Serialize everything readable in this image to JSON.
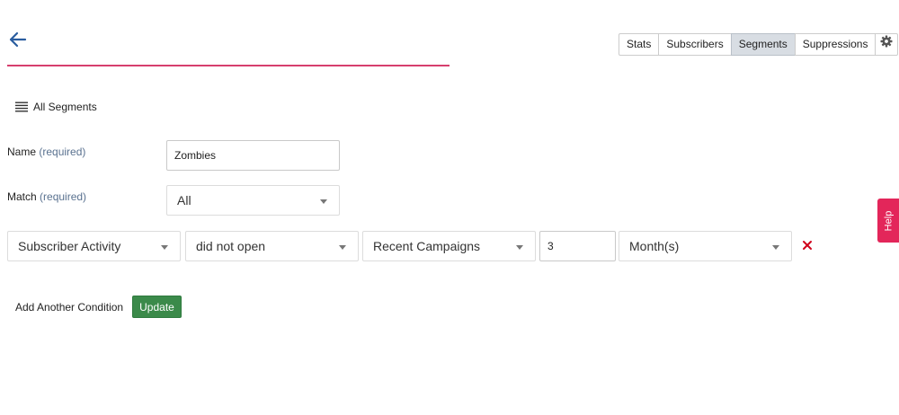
{
  "header": {
    "back_icon": "arrow-left-icon",
    "accent_color": "#d63f6e",
    "tabs": [
      {
        "label": "Stats",
        "active": false
      },
      {
        "label": "Subscribers",
        "active": false
      },
      {
        "label": "Segments",
        "active": true
      },
      {
        "label": "Suppressions",
        "active": false
      }
    ],
    "settings_icon": "gear-icon"
  },
  "nav": {
    "all_segments_label": "All Segments",
    "icon": "hamburger-list-icon"
  },
  "form": {
    "name": {
      "label": "Name",
      "required_text": "(required)",
      "value": "Zombies"
    },
    "match": {
      "label": "Match",
      "required_text": "(required)",
      "selected": "All"
    }
  },
  "condition": {
    "field": "Subscriber Activity",
    "operator": "did not open",
    "target": "Recent Campaigns",
    "count": "3",
    "unit": "Month(s)",
    "remove_icon": "close-x-icon",
    "remove_color": "#d0021b"
  },
  "actions": {
    "add_condition_label": "Add Another Condition",
    "update_label": "Update",
    "update_color": "#3b8a4a"
  },
  "help": {
    "label": "Help",
    "color": "#e3265a"
  }
}
